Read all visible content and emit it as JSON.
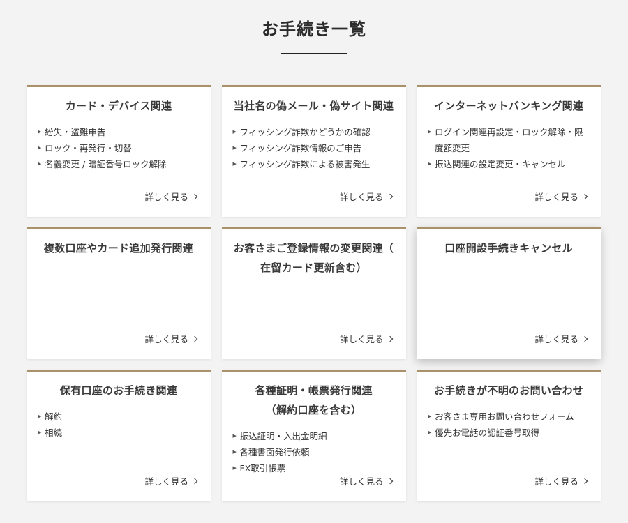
{
  "page": {
    "title": "お手続き一覧",
    "accent_color": "#a8916b"
  },
  "more_label": "詳しく見る",
  "cards": [
    {
      "title": "カード・デバイス関連",
      "items": [
        "紛失・盗難申告",
        "ロック・再発行・切替",
        "名義変更 / 暗証番号ロック解除"
      ]
    },
    {
      "title": "当社名の偽メール・偽サイト関連",
      "items": [
        "フィッシング詐欺かどうかの確認",
        "フィッシング詐欺情報のご申告",
        "フィッシング詐欺による被害発生"
      ]
    },
    {
      "title": "インターネットバンキング関連",
      "items": [
        "ログイン関連再設定・ロック解除・限度額変更",
        "振込関連の設定変更・キャンセル"
      ]
    },
    {
      "title": "複数口座やカード追加発行関連",
      "items": []
    },
    {
      "title": "お客さまご登録情報の変更関連（在留カード更新含む）",
      "items": []
    },
    {
      "title": "口座開設手続きキャンセル",
      "items": []
    },
    {
      "title": "保有口座のお手続き関連",
      "items": [
        "解約",
        "相続"
      ]
    },
    {
      "title": "各種証明・帳票発行関連（解約口座を含む）",
      "items": [
        "振込証明・入出金明細",
        "各種書面発行依頼",
        "FX取引帳票"
      ]
    },
    {
      "title": "お手続きが不明のお問い合わせ",
      "items": [
        "お客さま専用お問い合わせフォーム",
        "優先お電話の認証番号取得"
      ]
    }
  ]
}
